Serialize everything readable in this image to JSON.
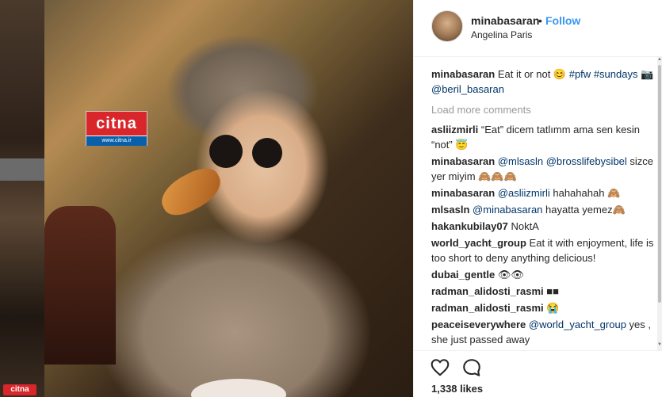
{
  "watermark": {
    "brand": "citna",
    "url": "www.citna.ir",
    "mini_brand": "citna"
  },
  "post": {
    "username": "minabasaran",
    "separator": "•",
    "follow_label": "Follow",
    "location": "Angelina Paris"
  },
  "caption": {
    "user": "minabasaran",
    "text": "Eat it or not 😊 ",
    "tags": [
      "#pfw",
      "#sundays",
      "📷",
      "@beril_basaran"
    ]
  },
  "load_more": "Load more comments",
  "comments": [
    {
      "user": "asliizmirli",
      "parts": [
        {
          "t": "text",
          "v": "“Eat” dicem tatlımm ama sen kesin “not” 😇"
        }
      ]
    },
    {
      "user": "minabasaran",
      "parts": [
        {
          "t": "tag",
          "v": "@mlsasln"
        },
        {
          "t": "text",
          "v": " "
        },
        {
          "t": "tag",
          "v": "@brosslifebysibel"
        },
        {
          "t": "text",
          "v": " sizce yer miyim 🙈🙈🙈"
        }
      ]
    },
    {
      "user": "minabasaran",
      "parts": [
        {
          "t": "tag",
          "v": "@asliizmirli"
        },
        {
          "t": "text",
          "v": " hahahahah 🙈"
        }
      ]
    },
    {
      "user": "mlsasln",
      "parts": [
        {
          "t": "tag",
          "v": "@minabasaran"
        },
        {
          "t": "text",
          "v": " hayatta yemez🙈"
        }
      ]
    },
    {
      "user": "hakankubilay07",
      "parts": [
        {
          "t": "text",
          "v": "NoktA"
        }
      ]
    },
    {
      "user": "world_yacht_group",
      "parts": [
        {
          "t": "text",
          "v": "Eat it with enjoyment, life is too short to deny anything delicious!"
        }
      ]
    },
    {
      "user": "dubai_gentle",
      "parts": [
        {
          "t": "text",
          "v": "👁👁"
        }
      ]
    },
    {
      "user": "radman_alidosti_rasmi",
      "parts": [
        {
          "t": "text",
          "v": "■■"
        }
      ]
    },
    {
      "user": "radman_alidosti_rasmi",
      "parts": [
        {
          "t": "text",
          "v": "😭"
        }
      ]
    },
    {
      "user": "peaceiseverywhere",
      "parts": [
        {
          "t": "tag",
          "v": "@world_yacht_group"
        },
        {
          "t": "text",
          "v": " yes , she just passed away"
        }
      ]
    }
  ],
  "actions": {
    "like_icon": "heart-outline-icon",
    "comment_icon": "comment-bubble-icon",
    "likes_text": "1,338 likes"
  }
}
